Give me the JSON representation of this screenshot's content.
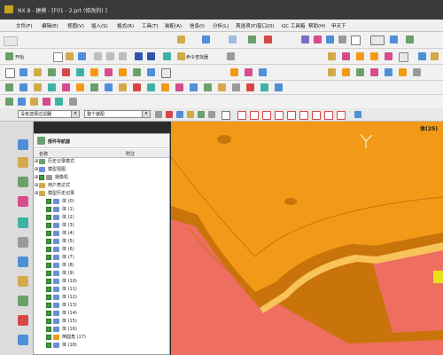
{
  "window": {
    "title": "NX 8 - 建模 - [F01 - 2.prt (修改的) ]"
  },
  "menu": [
    "文件(F)",
    "编辑(E)",
    "视图(V)",
    "插入(S)",
    "格式(R)",
    "工具(T)",
    "装配(A)",
    "信息(I)",
    "分析(L)",
    "首选项(P)",
    "窗口(O)",
    "GC 工具箱",
    "帮助(H)",
    "甲天下"
  ],
  "toolbar": {
    "start_label": "开始",
    "command_finder_label": "命令查找器"
  },
  "filter": {
    "selection_filter": "没有选择过滤器",
    "assembly_scope": "整个装配"
  },
  "viewport": {
    "body_label": "体(25)"
  },
  "navigator": {
    "title": "部件导航器",
    "columns": [
      "名称",
      "附注"
    ],
    "items": [
      {
        "label": "历史记录模式",
        "indent": 1,
        "icon": "history-mode-icon",
        "check": false
      },
      {
        "label": "模型视图",
        "indent": 1,
        "icon": "model-views-icon",
        "check": false
      },
      {
        "label": "摄像机",
        "indent": 1,
        "icon": "camera-icon",
        "check": true
      },
      {
        "label": "用户表达式",
        "indent": 1,
        "icon": "folder-icon",
        "check": false
      },
      {
        "label": "模型历史记录",
        "indent": 1,
        "icon": "folder-icon",
        "check": false
      },
      {
        "label": "体 (0)",
        "indent": 2,
        "icon": "body-icon",
        "check": true
      },
      {
        "label": "体 (1)",
        "indent": 2,
        "icon": "body-icon",
        "check": true
      },
      {
        "label": "体 (2)",
        "indent": 2,
        "icon": "body-icon",
        "check": true
      },
      {
        "label": "体 (3)",
        "indent": 2,
        "icon": "body-icon",
        "check": true
      },
      {
        "label": "体 (4)",
        "indent": 2,
        "icon": "body-icon",
        "check": true
      },
      {
        "label": "体 (5)",
        "indent": 2,
        "icon": "body-icon",
        "check": true
      },
      {
        "label": "体 (6)",
        "indent": 2,
        "icon": "body-icon",
        "check": true
      },
      {
        "label": "体 (7)",
        "indent": 2,
        "icon": "body-icon",
        "check": true
      },
      {
        "label": "体 (8)",
        "indent": 2,
        "icon": "body-icon",
        "check": true
      },
      {
        "label": "体 (9)",
        "indent": 2,
        "icon": "body-icon",
        "check": true
      },
      {
        "label": "体 (10)",
        "indent": 2,
        "icon": "body-icon",
        "check": true
      },
      {
        "label": "体 (11)",
        "indent": 2,
        "icon": "body-icon",
        "check": true
      },
      {
        "label": "体 (12)",
        "indent": 2,
        "icon": "body-icon",
        "check": true
      },
      {
        "label": "体 (13)",
        "indent": 2,
        "icon": "body-icon",
        "check": true
      },
      {
        "label": "体 (14)",
        "indent": 2,
        "icon": "body-icon",
        "check": true
      },
      {
        "label": "体 (15)",
        "indent": 2,
        "icon": "body-icon",
        "check": true
      },
      {
        "label": "体 (16)",
        "indent": 2,
        "icon": "body-icon",
        "check": true
      },
      {
        "label": "倒圆角 (17)",
        "indent": 2,
        "icon": "edge-blend-icon",
        "check": true
      },
      {
        "label": "体 (18)",
        "indent": 2,
        "icon": "body-icon",
        "check": true
      }
    ]
  },
  "colors": {
    "part_orange": "#f29a17",
    "part_orange_dark": "#c9740a",
    "part_edge_light": "#f8c35a",
    "base_salmon": "#ee6e5f",
    "accent_yellow": "#e8e21c",
    "check_green": "#3d9b3d"
  }
}
